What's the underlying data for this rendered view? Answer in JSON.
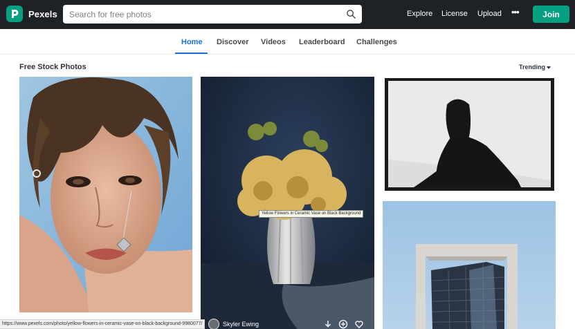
{
  "app": {
    "brand": "Pexels"
  },
  "search": {
    "placeholder": "Search for free photos"
  },
  "header_nav": {
    "explore": "Explore",
    "license": "License",
    "upload": "Upload",
    "more": "•••",
    "join": "Join"
  },
  "tabs": [
    {
      "label": "Home",
      "active": true
    },
    {
      "label": "Discover",
      "active": false
    },
    {
      "label": "Videos",
      "active": false
    },
    {
      "label": "Leaderboard",
      "active": false
    },
    {
      "label": "Challenges",
      "active": false
    }
  ],
  "section": {
    "title": "Free Stock Photos",
    "sort": "Trending"
  },
  "photos": {
    "hover_title": "Yellow Flowers in Ceramic Vase on Black Background",
    "photographer": "Skyler Ewing"
  },
  "status_bar": {
    "url": "https://www.pexels.com/photo/yellow-flowers-in-ceramic-vase-on-black-background-9980077/"
  },
  "colors": {
    "brand_green": "#05a081",
    "topbar": "#1e2126",
    "active_tab": "#1a6fd8"
  }
}
